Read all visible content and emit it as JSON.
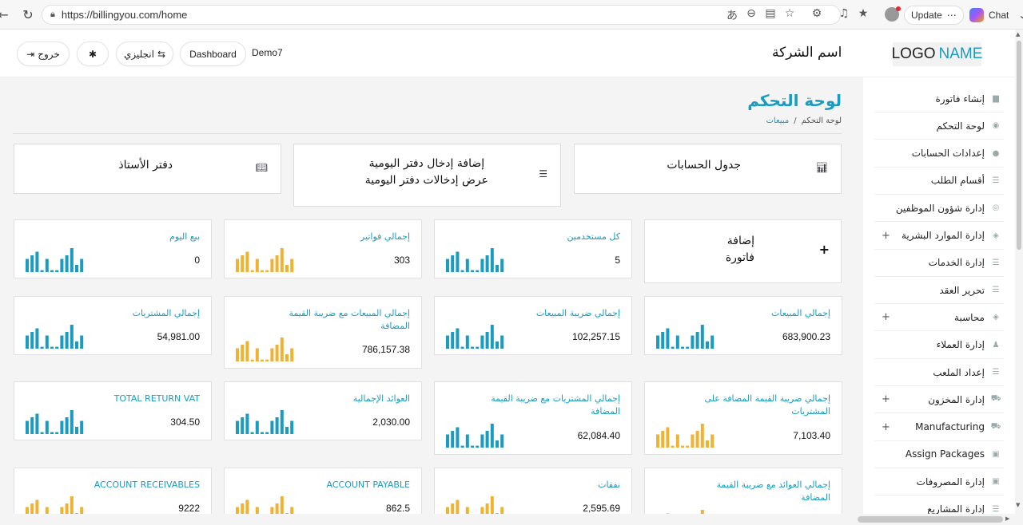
{
  "browser": {
    "url": "https://billingyou.com/home",
    "update_label": "Update",
    "update_more": "⋯",
    "chat_label": "Chat"
  },
  "header": {
    "logout_label": "خروج",
    "settings_icon": "gear-icon",
    "language_label": "انجليزي",
    "dashboard_label": "Dashboard",
    "user_name": "Demo7",
    "company_name": "اسم الشركة",
    "logo_text": "LOGO",
    "logo_accent": "NAME"
  },
  "page": {
    "title": "لوحة التحكم",
    "breadcrumb_home": "لوحة التحكم",
    "breadcrumb_sep": "/",
    "breadcrumb_current": "مبيعات"
  },
  "quick_links": {
    "accounts_chart": "جدول الحسابات",
    "journal_add": "إضافة إدخال دفتر اليومية",
    "journal_view": "عرض إدخالات دفتر اليومية",
    "ledger": "دفتر الأستاذ"
  },
  "add_invoice": {
    "line1": "إضافة",
    "line2": "فاتورة",
    "plus": "+"
  },
  "cards": [
    {
      "label": "كل مستخدمين",
      "value": "5",
      "color": "#1a9bbf"
    },
    {
      "label": "إجمالي فواتير",
      "value": "303",
      "color": "#f0b232"
    },
    {
      "label": "بيع اليوم",
      "value": "0",
      "color": "#1a9bbf"
    },
    {
      "label": "إجمالي المبيعات",
      "value": "683,900.23",
      "color": "#1a9bbf"
    },
    {
      "label": "إجمالي ضريبة المبيعات",
      "value": "102,257.15",
      "color": "#1a9bbf"
    },
    {
      "label": "إجمالي المبيعات مع ضريبة القيمة المضافة",
      "value": "786,157.38",
      "color": "#f0b232"
    },
    {
      "label": "إجمالي المشتريات",
      "value": "54,981.00",
      "color": "#1a9bbf"
    },
    {
      "label": "إجمالي ضريبة القيمة المضافة على المشتريات",
      "value": "7,103.40",
      "color": "#f0b232"
    },
    {
      "label": "إجمالي المشتريات مع ضريبة القيمة المضافة",
      "value": "62,084.40",
      "color": "#1a9bbf"
    },
    {
      "label": "العوائد الإجمالية",
      "value": "2,030.00",
      "color": "#1a9bbf"
    },
    {
      "label": "TOTAL RETURN VAT",
      "value": "304.50",
      "color": "#1a9bbf"
    },
    {
      "label": "إجمالي العوائد مع ضريبة القيمة المضافة",
      "value": "",
      "color": "#f0b232"
    },
    {
      "label": "نفقات",
      "value": "2,595.69",
      "color": "#f0b232"
    },
    {
      "label": "ACCOUNT PAYABLE",
      "value": "862.5",
      "color": "#f0b232"
    },
    {
      "label": "ACCOUNT RECEIVABLES",
      "value": "9222",
      "color": "#f0b232"
    }
  ],
  "sidebar": {
    "items": [
      {
        "label": "إنشاء فاتورة",
        "icon": "file-icon",
        "expandable": false
      },
      {
        "label": "لوحة التحكم",
        "icon": "dashboard-icon",
        "expandable": false
      },
      {
        "label": "إعدادات الحسابات",
        "icon": "user-icon",
        "expandable": false
      },
      {
        "label": "أقسام الطلب",
        "icon": "list-icon",
        "expandable": false
      },
      {
        "label": "إدارة شؤون الموظفين",
        "icon": "user-circle-icon",
        "expandable": false
      },
      {
        "label": "إدارة الموارد البشرية",
        "icon": "cube-icon",
        "expandable": true
      },
      {
        "label": "إدارة الخدمات",
        "icon": "list-icon",
        "expandable": false
      },
      {
        "label": "تحرير العقد",
        "icon": "list-icon",
        "expandable": false
      },
      {
        "label": "محاسبة",
        "icon": "cube-icon",
        "expandable": true
      },
      {
        "label": "إدارة العملاء",
        "icon": "users-icon",
        "expandable": false
      },
      {
        "label": "إعداد الملعب",
        "icon": "list-icon",
        "expandable": false
      },
      {
        "label": "إدارة المخزون",
        "icon": "cart-icon",
        "expandable": true
      },
      {
        "label": "Manufacturing",
        "icon": "cart-icon",
        "expandable": true
      },
      {
        "label": "Assign Packages",
        "icon": "money-icon",
        "expandable": false
      },
      {
        "label": "إدارة المصروفات",
        "icon": "money-icon",
        "expandable": false
      },
      {
        "label": "إدارة المشاريع",
        "icon": "list-icon",
        "expandable": false
      }
    ]
  }
}
